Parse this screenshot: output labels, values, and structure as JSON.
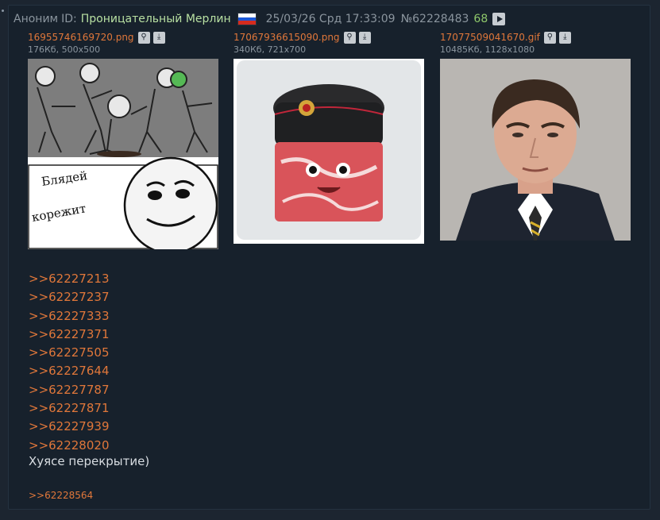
{
  "header": {
    "anon": "Аноним",
    "id_label": "ID:",
    "id_name": "Проницательный Мерлин",
    "flag_icon": "russia-flag-icon",
    "date": "25/03/26 Срд 17:33:09",
    "post_number": "№62228483",
    "post_count": "68"
  },
  "files": [
    {
      "name": "16955746169720.png",
      "meta": "176Кб, 500x500",
      "description": "meme comic"
    },
    {
      "name": "17067936615090.png",
      "meta": "340Кб, 721x700",
      "description": "cartoon meat cube with ushanka hat"
    },
    {
      "name": "17077509041670.gif",
      "meta": "10485Кб, 1128x1080",
      "description": "photo of man with confused expression"
    }
  ],
  "file_buttons": {
    "search": "search-icon",
    "download": "download-icon"
  },
  "replies": [
    ">>62227213",
    ">>62227237",
    ">>62227333",
    ">>62227371",
    ">>62227505",
    ">>62227644",
    ">>62227787",
    ">>62227871",
    ">>62227939",
    ">>62228020"
  ],
  "message": "Хуясе перекрытие)",
  "backlink": ">>62228564",
  "meme_text": {
    "line1": "Блядей",
    "line2": "корежит"
  },
  "colors": {
    "background": "#1c2530",
    "post_bg": "#17212c",
    "link": "#e0773a",
    "name": "#b8e0a2",
    "count": "#8fc86b",
    "text": "#d8dde2",
    "muted": "#8b959e"
  }
}
